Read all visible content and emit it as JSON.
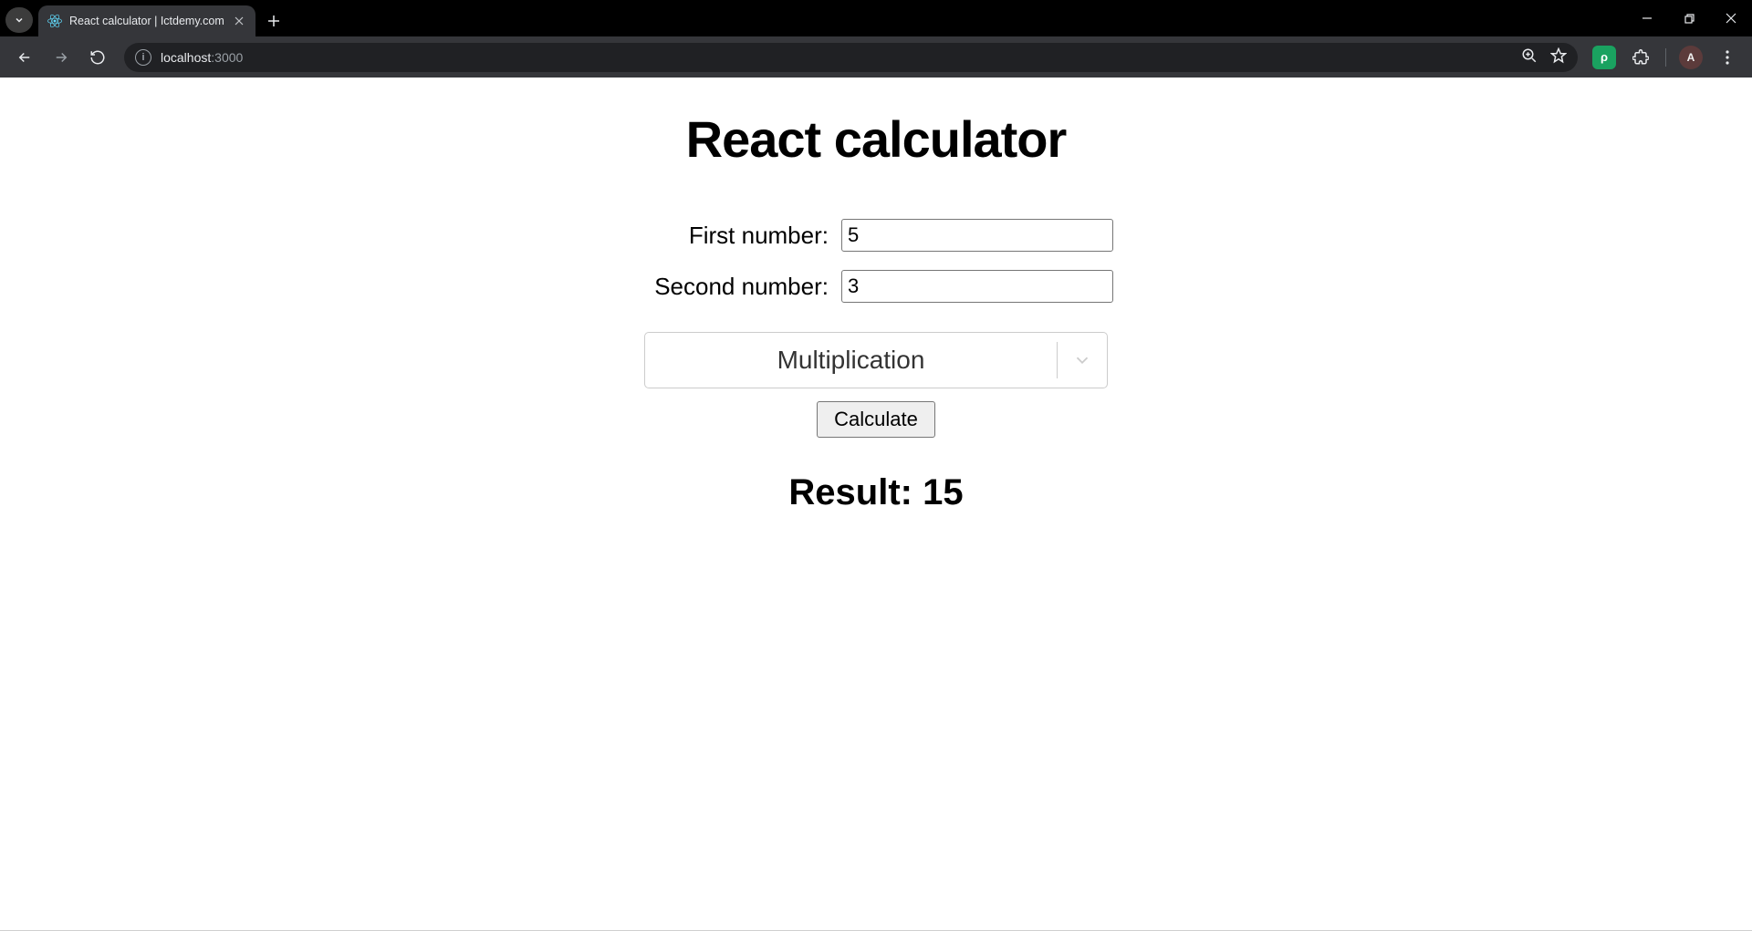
{
  "browser": {
    "tab_title": "React calculator | Ictdemy.com",
    "url_host": "localhost",
    "url_port": ":3000",
    "profile_initial": "A"
  },
  "page": {
    "title": "React calculator",
    "first_number_label": "First number:",
    "first_number_value": "5",
    "second_number_label": "Second number:",
    "second_number_value": "3",
    "operation_selected": "Multiplication",
    "calculate_label": "Calculate",
    "result_prefix": "Result: ",
    "result_value": "15"
  }
}
